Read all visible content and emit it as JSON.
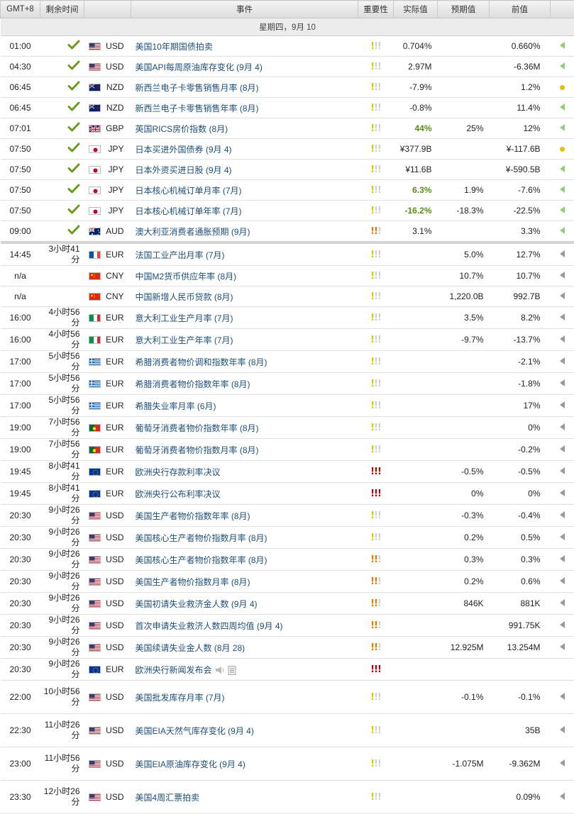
{
  "header": {
    "time": "GMT+8",
    "remaining": "剩余时间",
    "event": "事件",
    "importance": "重要性",
    "actual": "实际值",
    "forecast": "预期值",
    "previous": "前值"
  },
  "day_label": "星期四，9月 10",
  "colors": {
    "link": "#1f4e79",
    "positive": "#5d8c1d",
    "bang_low": "#e0c600",
    "bang_mid": "#e07b00",
    "bang_high": "#b00000",
    "bang_off": "#d0d0d0"
  },
  "events": [
    {
      "time": "01:00",
      "remaining": "",
      "done": true,
      "flag": "us",
      "currency": "USD",
      "name": "美国10年期国债拍卖",
      "imp": 1,
      "actual": "0.704%",
      "actual_up": false,
      "forecast": "",
      "previous": "0.660%",
      "mark": "tri-green"
    },
    {
      "time": "04:30",
      "remaining": "",
      "done": true,
      "flag": "us",
      "currency": "USD",
      "name": "美国API每周原油库存变化 (9月 4)",
      "imp": 1,
      "actual": "2.97M",
      "actual_up": false,
      "forecast": "",
      "previous": "-6.36M",
      "mark": "tri-green"
    },
    {
      "time": "06:45",
      "remaining": "",
      "done": true,
      "flag": "nz",
      "currency": "NZD",
      "name": "新西兰电子卡零售销售月率 (8月)",
      "imp": 1,
      "actual": "-7.9%",
      "actual_up": false,
      "forecast": "",
      "previous": "1.2%",
      "mark": "dot"
    },
    {
      "time": "06:45",
      "remaining": "",
      "done": true,
      "flag": "nz",
      "currency": "NZD",
      "name": "新西兰电子卡零售销售年率 (8月)",
      "imp": 1,
      "actual": "-0.8%",
      "actual_up": false,
      "forecast": "",
      "previous": "11.4%",
      "mark": "tri-green"
    },
    {
      "time": "07:01",
      "remaining": "",
      "done": true,
      "flag": "gb",
      "currency": "GBP",
      "name": "英国RICS房价指数 (8月)",
      "imp": 1,
      "actual": "44%",
      "actual_up": true,
      "forecast": "25%",
      "previous": "12%",
      "mark": "tri-green"
    },
    {
      "time": "07:50",
      "remaining": "",
      "done": true,
      "flag": "jp",
      "currency": "JPY",
      "name": "日本买进外国债券 (9月 4)",
      "imp": 1,
      "actual": "¥377.9B",
      "actual_up": false,
      "forecast": "",
      "previous": "¥-117.6B",
      "mark": "dot"
    },
    {
      "time": "07:50",
      "remaining": "",
      "done": true,
      "flag": "jp",
      "currency": "JPY",
      "name": "日本外资买进日股 (9月 4)",
      "imp": 1,
      "actual": "¥11.6B",
      "actual_up": false,
      "forecast": "",
      "previous": "¥-590.5B",
      "mark": "tri-green"
    },
    {
      "time": "07:50",
      "remaining": "",
      "done": true,
      "flag": "jp",
      "currency": "JPY",
      "name": "日本核心机械订单月率 (7月)",
      "imp": 1,
      "actual": "6.3%",
      "actual_up": true,
      "forecast": "1.9%",
      "previous": "-7.6%",
      "mark": "tri-green"
    },
    {
      "time": "07:50",
      "remaining": "",
      "done": true,
      "flag": "jp",
      "currency": "JPY",
      "name": "日本核心机械订单年率 (7月)",
      "imp": 1,
      "actual": "-16.2%",
      "actual_up": true,
      "forecast": "-18.3%",
      "previous": "-22.5%",
      "mark": "tri-green"
    },
    {
      "time": "09:00",
      "remaining": "",
      "done": true,
      "flag": "au",
      "currency": "AUD",
      "name": "澳大利亚消费者通胀预期 (9月)",
      "imp": 2,
      "actual": "3.1%",
      "actual_up": false,
      "forecast": "",
      "previous": "3.3%",
      "mark": "tri-green"
    },
    {
      "time": "14:45",
      "remaining": "3小时41分",
      "done": false,
      "flag": "fr",
      "currency": "EUR",
      "name": "法国工业产出月率 (7月)",
      "imp": 1,
      "actual": "",
      "actual_up": false,
      "forecast": "5.0%",
      "previous": "12.7%",
      "mark": "tri",
      "sep": true
    },
    {
      "time": "n/a",
      "remaining": "",
      "done": false,
      "flag": "cn",
      "currency": "CNY",
      "name": "中国M2货币供应年率 (8月)",
      "imp": 1,
      "actual": "",
      "actual_up": false,
      "forecast": "10.7%",
      "previous": "10.7%",
      "mark": "tri"
    },
    {
      "time": "n/a",
      "remaining": "",
      "done": false,
      "flag": "cn",
      "currency": "CNY",
      "name": "中国新增人民币贷款 (8月)",
      "imp": 1,
      "actual": "",
      "actual_up": false,
      "forecast": "1,220.0B",
      "previous": "992.7B",
      "mark": "tri"
    },
    {
      "time": "16:00",
      "remaining": "4小时56分",
      "done": false,
      "flag": "it",
      "currency": "EUR",
      "name": "意大利工业生产月率 (7月)",
      "imp": 1,
      "actual": "",
      "actual_up": false,
      "forecast": "3.5%",
      "previous": "8.2%",
      "mark": "tri"
    },
    {
      "time": "16:00",
      "remaining": "4小时56分",
      "done": false,
      "flag": "it",
      "currency": "EUR",
      "name": "意大利工业生产年率 (7月)",
      "imp": 1,
      "actual": "",
      "actual_up": false,
      "forecast": "-9.7%",
      "previous": "-13.7%",
      "mark": "tri"
    },
    {
      "time": "17:00",
      "remaining": "5小时56分",
      "done": false,
      "flag": "gr",
      "currency": "EUR",
      "name": "希腊消费者物价调和指数年率 (8月)",
      "imp": 1,
      "actual": "",
      "actual_up": false,
      "forecast": "",
      "previous": "-2.1%",
      "mark": "tri"
    },
    {
      "time": "17:00",
      "remaining": "5小时56分",
      "done": false,
      "flag": "gr",
      "currency": "EUR",
      "name": "希腊消费者物价指数年率 (8月)",
      "imp": 1,
      "actual": "",
      "actual_up": false,
      "forecast": "",
      "previous": "-1.8%",
      "mark": "tri"
    },
    {
      "time": "17:00",
      "remaining": "5小时56分",
      "done": false,
      "flag": "gr",
      "currency": "EUR",
      "name": "希腊失业率月率 (6月)",
      "imp": 1,
      "actual": "",
      "actual_up": false,
      "forecast": "",
      "previous": "17%",
      "mark": "tri"
    },
    {
      "time": "19:00",
      "remaining": "7小时56分",
      "done": false,
      "flag": "pt",
      "currency": "EUR",
      "name": "葡萄牙消费者物价指数年率 (8月)",
      "imp": 1,
      "actual": "",
      "actual_up": false,
      "forecast": "",
      "previous": "0%",
      "mark": "tri"
    },
    {
      "time": "19:00",
      "remaining": "7小时56分",
      "done": false,
      "flag": "pt",
      "currency": "EUR",
      "name": "葡萄牙消费者物价指数月率 (8月)",
      "imp": 1,
      "actual": "",
      "actual_up": false,
      "forecast": "",
      "previous": "-0.2%",
      "mark": "tri"
    },
    {
      "time": "19:45",
      "remaining": "8小时41分",
      "done": false,
      "flag": "eu",
      "currency": "EUR",
      "name": "欧洲央行存款利率决议",
      "imp": 3,
      "actual": "",
      "actual_up": false,
      "forecast": "-0.5%",
      "previous": "-0.5%",
      "mark": "tri"
    },
    {
      "time": "19:45",
      "remaining": "8小时41分",
      "done": false,
      "flag": "eu",
      "currency": "EUR",
      "name": "欧洲央行公布利率决议",
      "imp": 3,
      "actual": "",
      "actual_up": false,
      "forecast": "0%",
      "previous": "0%",
      "mark": "tri"
    },
    {
      "time": "20:30",
      "remaining": "9小时26分",
      "done": false,
      "flag": "us",
      "currency": "USD",
      "name": "美国生产者物价指数年率 (8月)",
      "imp": 1,
      "actual": "",
      "actual_up": false,
      "forecast": "-0.3%",
      "previous": "-0.4%",
      "mark": "tri"
    },
    {
      "time": "20:30",
      "remaining": "9小时26分",
      "done": false,
      "flag": "us",
      "currency": "USD",
      "name": "美国核心生产者物价指数月率 (8月)",
      "imp": 1,
      "actual": "",
      "actual_up": false,
      "forecast": "0.2%",
      "previous": "0.5%",
      "mark": "tri"
    },
    {
      "time": "20:30",
      "remaining": "9小时26分",
      "done": false,
      "flag": "us",
      "currency": "USD",
      "name": "美国核心生产者物价指数年率 (8月)",
      "imp": 2,
      "actual": "",
      "actual_up": false,
      "forecast": "0.3%",
      "previous": "0.3%",
      "mark": "tri"
    },
    {
      "time": "20:30",
      "remaining": "9小时26分",
      "done": false,
      "flag": "us",
      "currency": "USD",
      "name": "美国生产者物价指数月率 (8月)",
      "imp": 2,
      "actual": "",
      "actual_up": false,
      "forecast": "0.2%",
      "previous": "0.6%",
      "mark": "tri"
    },
    {
      "time": "20:30",
      "remaining": "9小时26分",
      "done": false,
      "flag": "us",
      "currency": "USD",
      "name": "美国初请失业救济金人数 (9月 4)",
      "imp": 2,
      "actual": "",
      "actual_up": false,
      "forecast": "846K",
      "previous": "881K",
      "mark": "tri"
    },
    {
      "time": "20:30",
      "remaining": "9小时26分",
      "done": false,
      "flag": "us",
      "currency": "USD",
      "name": "首次申请失业救济人数四周均值 (9月 4)",
      "imp": 2,
      "actual": "",
      "actual_up": false,
      "forecast": "",
      "previous": "991.75K",
      "mark": "tri"
    },
    {
      "time": "20:30",
      "remaining": "9小时26分",
      "done": false,
      "flag": "us",
      "currency": "USD",
      "name": "美国续请失业金人数 (8月 28)",
      "imp": 2,
      "actual": "",
      "actual_up": false,
      "forecast": "12.925M",
      "previous": "13.254M",
      "mark": "tri"
    },
    {
      "time": "20:30",
      "remaining": "9小时26分",
      "done": false,
      "flag": "eu",
      "currency": "EUR",
      "name": "欧洲央行新闻发布会",
      "imp": 3,
      "actual": "",
      "actual_up": false,
      "forecast": "",
      "previous": "",
      "mark": "",
      "icons": true
    },
    {
      "time": "22:00",
      "remaining": "10小时56分",
      "done": false,
      "flag": "us",
      "currency": "USD",
      "name": "美国批发库存月率 (7月)",
      "imp": 1,
      "actual": "",
      "actual_up": false,
      "forecast": "-0.1%",
      "previous": "-0.1%",
      "mark": "tri",
      "tall": true
    },
    {
      "time": "22:30",
      "remaining": "11小时26分",
      "done": false,
      "flag": "us",
      "currency": "USD",
      "name": "美国EIA天然气库存变化 (9月 4)",
      "imp": 1,
      "actual": "",
      "actual_up": false,
      "forecast": "",
      "previous": "35B",
      "mark": "tri",
      "tall": true
    },
    {
      "time": "23:00",
      "remaining": "11小时56分",
      "done": false,
      "flag": "us",
      "currency": "USD",
      "name": "美国EIA原油库存变化 (9月 4)",
      "imp": 1,
      "actual": "",
      "actual_up": false,
      "forecast": "-1.075M",
      "previous": "-9.362M",
      "mark": "tri",
      "tall": true
    },
    {
      "time": "23:30",
      "remaining": "12小时26分",
      "done": false,
      "flag": "us",
      "currency": "USD",
      "name": "美国4周汇票拍卖",
      "imp": 1,
      "actual": "",
      "actual_up": false,
      "forecast": "",
      "previous": "0.09%",
      "mark": "tri",
      "tall": true
    }
  ]
}
